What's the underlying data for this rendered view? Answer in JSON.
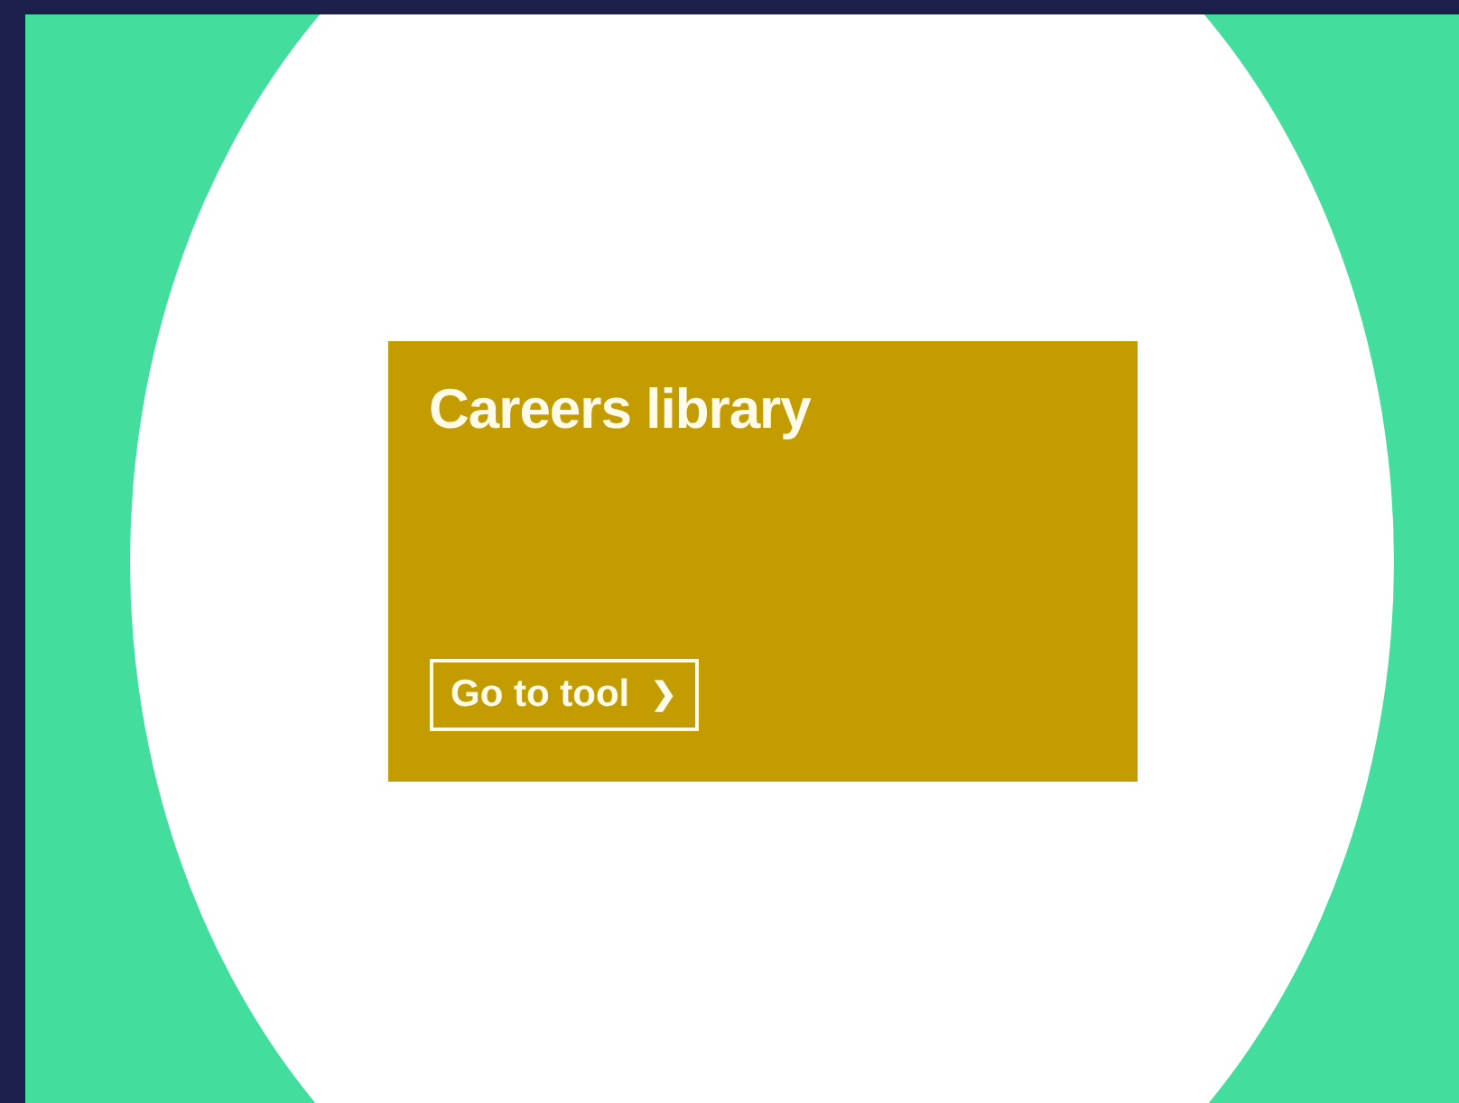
{
  "card": {
    "title": "Careers library",
    "button": {
      "label": "Go to tool",
      "icon": "❯"
    }
  }
}
